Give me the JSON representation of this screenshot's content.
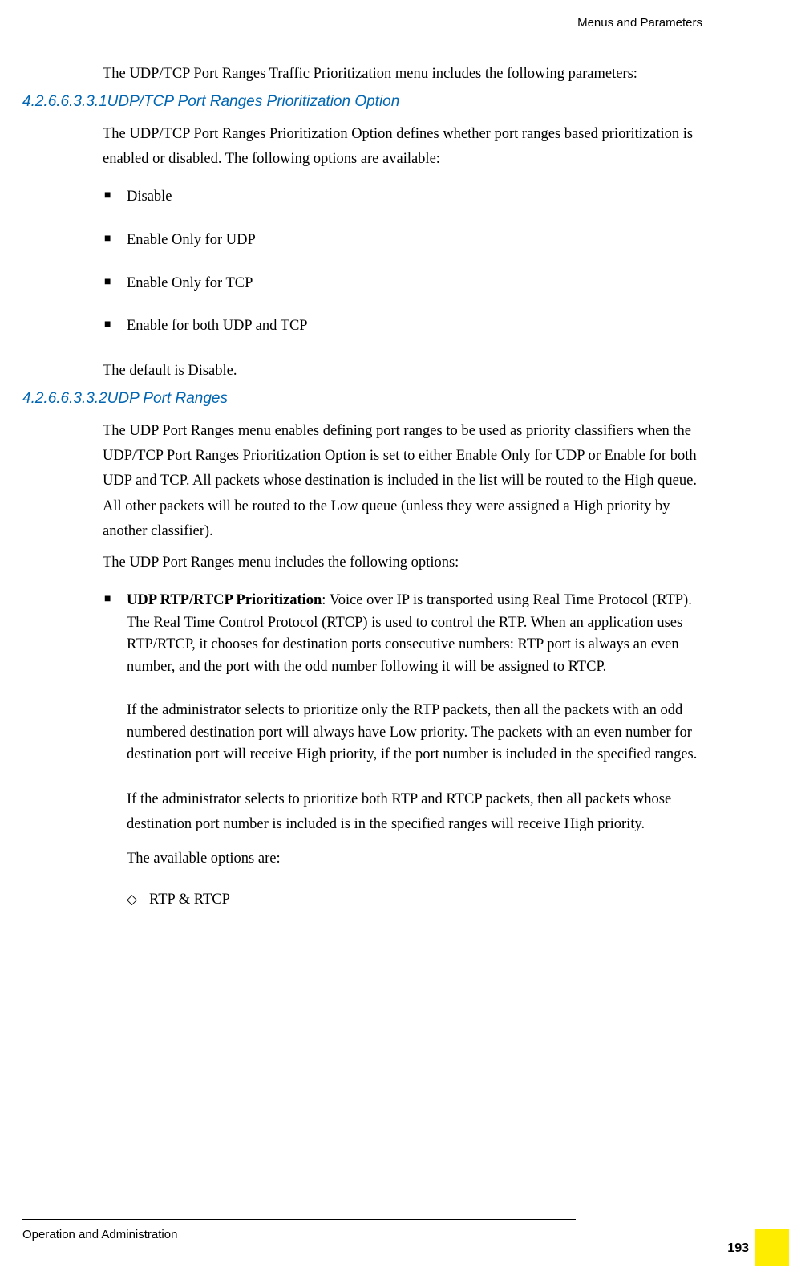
{
  "header": {
    "title": "Menus and Parameters"
  },
  "intro": "The UDP/TCP Port Ranges Traffic Prioritization menu includes the following parameters:",
  "section1": {
    "num": "4.2.6.6.3.3.1",
    "title": "UDP/TCP Port Ranges Prioritization Option",
    "para1": "The UDP/TCP Port Ranges Prioritization Option defines whether port ranges based prioritization is enabled or disabled. The following options are available:",
    "options": [
      "Disable",
      "Enable Only for UDP",
      "Enable Only for TCP",
      "Enable for both UDP and TCP"
    ],
    "para2": "The default is Disable."
  },
  "section2": {
    "num": "4.2.6.6.3.3.2",
    "title": "UDP Port Ranges",
    "para1": "The UDP Port Ranges menu enables defining port ranges to be used as priority classifiers when the UDP/TCP Port Ranges Prioritization Option is set to either Enable Only for UDP or Enable for both UDP and TCP. All packets whose destination is included in the list will be routed to the High queue. All other packets will be routed to the Low queue (unless they were assigned a High priority by another classifier).",
    "para2": "The UDP Port Ranges menu includes the following options:",
    "bullet": {
      "bold": "UDP RTP/RTCP Prioritization",
      "text1": ": Voice over IP is transported using Real Time Protocol (RTP). The Real Time Control Protocol (RTCP) is used to control the RTP. When an application uses RTP/RTCP, it chooses for destination ports consecutive numbers: RTP port is always an even number, and the port with the odd number following it will be assigned to RTCP.",
      "text2": "If the administrator selects to prioritize only the RTP packets, then all the packets with an odd numbered destination port will always have Low priority. The packets with an even number for destination port will receive High priority, if the port number is included in the specified ranges."
    },
    "subpara1": "If the administrator selects to prioritize both RTP and RTCP packets, then all packets whose destination port number is included is in the specified ranges will receive High priority.",
    "subpara2": "The available options are:",
    "diamond1": "RTP & RTCP"
  },
  "footer": {
    "text": "Operation and Administration",
    "pageNum": "193"
  }
}
